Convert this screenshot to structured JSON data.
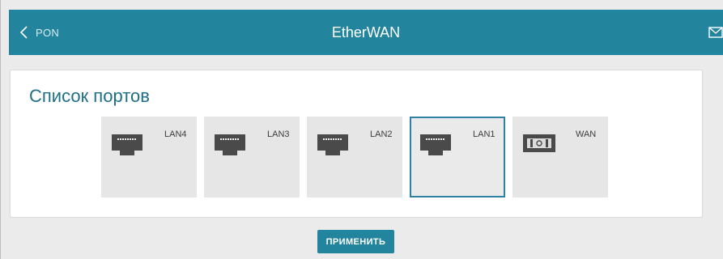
{
  "header": {
    "back_label": "PON",
    "title": "EtherWAN"
  },
  "icons": {
    "back": "chevron-left-icon",
    "mail": "mail-icon",
    "lan_port": "ethernet-port-icon",
    "wan_port": "wan-port-icon"
  },
  "card": {
    "title": "Список портов"
  },
  "ports": [
    {
      "label": "LAN4",
      "type": "lan",
      "selected": false
    },
    {
      "label": "LAN3",
      "type": "lan",
      "selected": false
    },
    {
      "label": "LAN2",
      "type": "lan",
      "selected": false
    },
    {
      "label": "LAN1",
      "type": "lan",
      "selected": true
    },
    {
      "label": "WAN",
      "type": "wan",
      "selected": false
    }
  ],
  "actions": {
    "apply_label": "ПРИМЕНИТЬ"
  },
  "colors": {
    "accent": "#22849d",
    "title_text": "#1d6f88",
    "selected_border": "#2c82a0"
  }
}
